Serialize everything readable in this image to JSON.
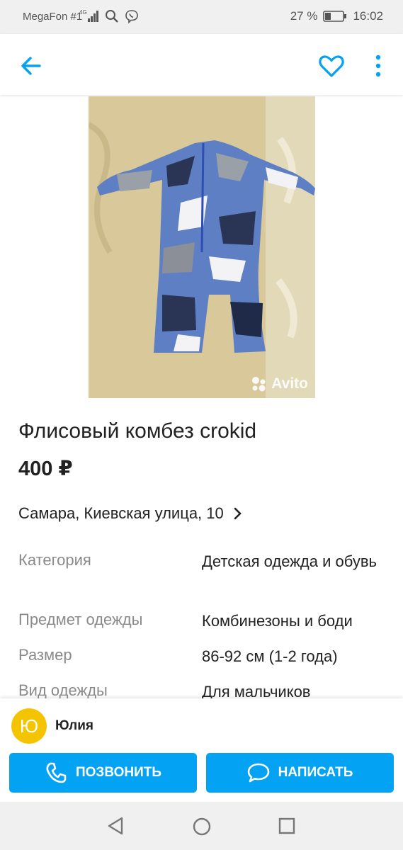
{
  "status_bar": {
    "carrier": "MegaFon #1",
    "network": "4G",
    "battery_percent": "27 %",
    "time": "16:02",
    "icons": [
      "signal-icon",
      "search-icon",
      "viber-icon",
      "battery-icon"
    ]
  },
  "app_bar": {
    "icons": [
      "back-arrow-icon",
      "heart-icon",
      "more-vert-icon"
    ],
    "accent_color": "#04a2f3"
  },
  "listing": {
    "photo_watermark": "Avito",
    "title": "Флисовый комбез crokid",
    "price": "400 ₽",
    "address": "Самара, Киевская улица, 10",
    "params": [
      {
        "label": "Категория",
        "value": "Детская одежда и обувь"
      },
      {
        "label": "Предмет одежды",
        "value": "Комбинезоны и боди"
      },
      {
        "label": "Размер",
        "value": "86-92 см (1-2 года)"
      },
      {
        "label": "Вид одежды",
        "value": "Для мальчиков"
      }
    ]
  },
  "seller": {
    "avatar_letter": "Ю",
    "avatar_color": "#f5c400",
    "name": "Юлия"
  },
  "actions": {
    "call_label": "ПОЗВОНИТЬ",
    "write_label": "НАПИСАТЬ",
    "button_color": "#04a2f3"
  }
}
